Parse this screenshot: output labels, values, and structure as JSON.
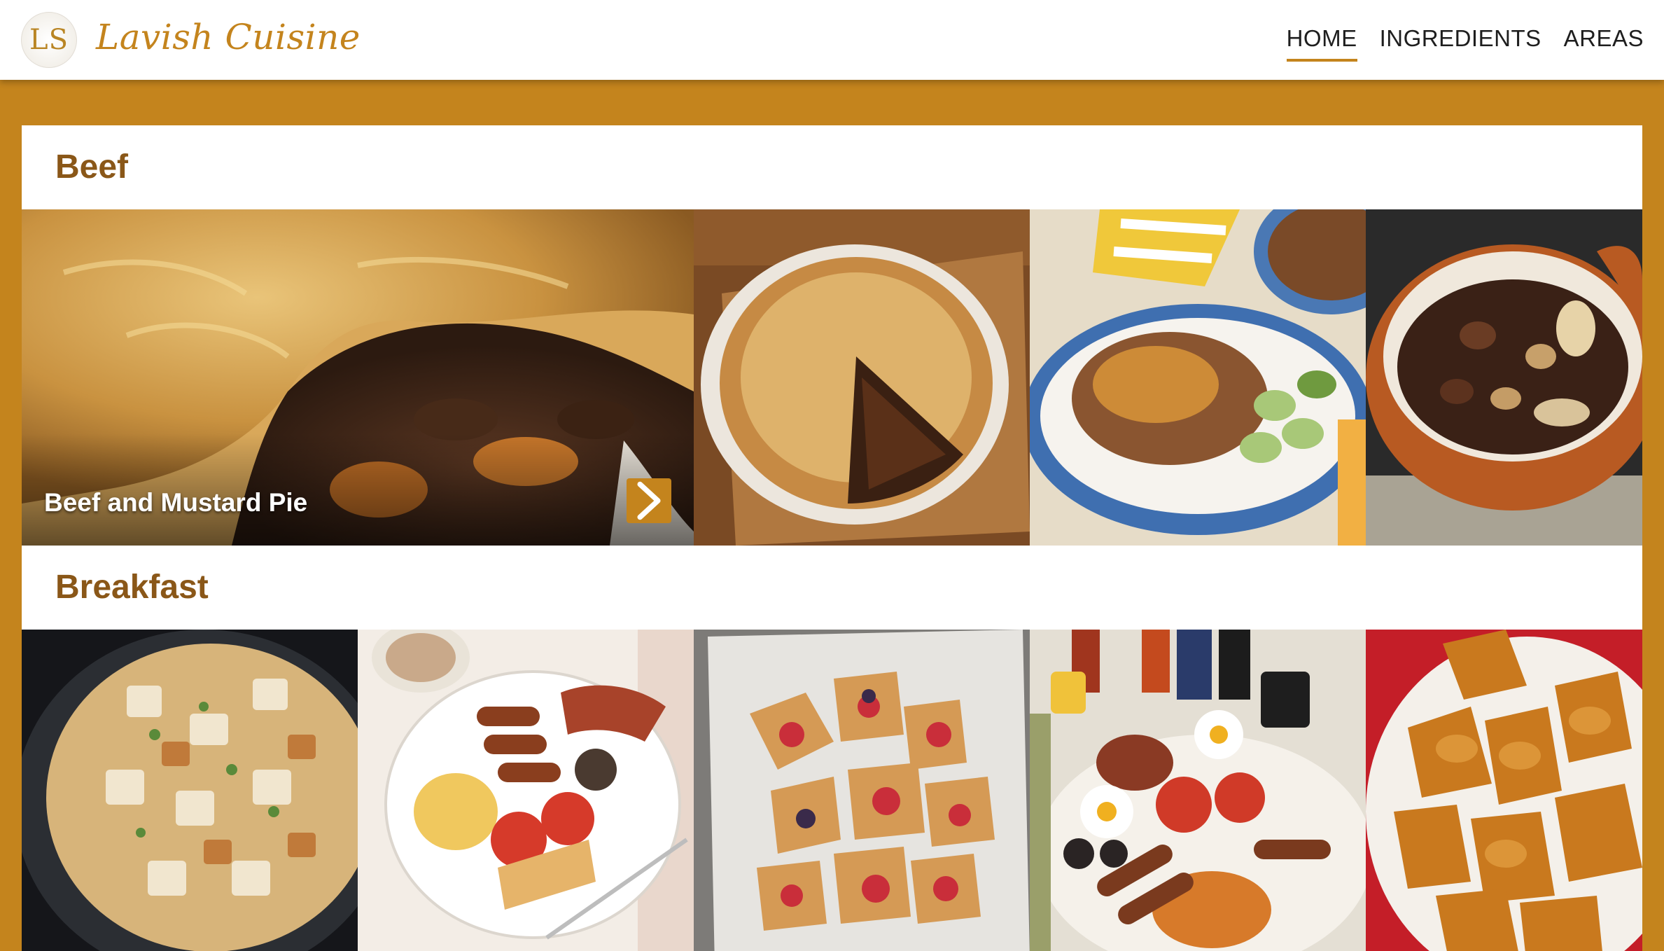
{
  "header": {
    "logo_initials": "LS",
    "brand": "Lavish Cuisine",
    "nav": [
      {
        "label": "HOME",
        "active": true
      },
      {
        "label": "INGREDIENTS",
        "active": false
      },
      {
        "label": "AREAS",
        "active": false
      }
    ]
  },
  "sections": [
    {
      "title": "Beef",
      "featured_meal": "Beef and Mustard Pie",
      "tiles": [
        {
          "image": "beef-pie-closeup-photo"
        },
        {
          "image": "beef-pie-sliced-photo"
        },
        {
          "image": "mince-rice-bowl-photo"
        },
        {
          "image": "beef-stew-pot-photo"
        }
      ]
    },
    {
      "title": "Breakfast",
      "tiles": [
        {
          "image": "breakfast-potato-skillet-photo"
        },
        {
          "image": "english-breakfast-plate-photo"
        },
        {
          "image": "fruit-pastries-photo"
        },
        {
          "image": "full-breakfast-platter-photo"
        },
        {
          "image": "fried-dough-photo"
        }
      ]
    }
  ],
  "colors": {
    "accent": "#c4841d",
    "section_title": "#8a5718",
    "header_bg": "#ffffff"
  }
}
